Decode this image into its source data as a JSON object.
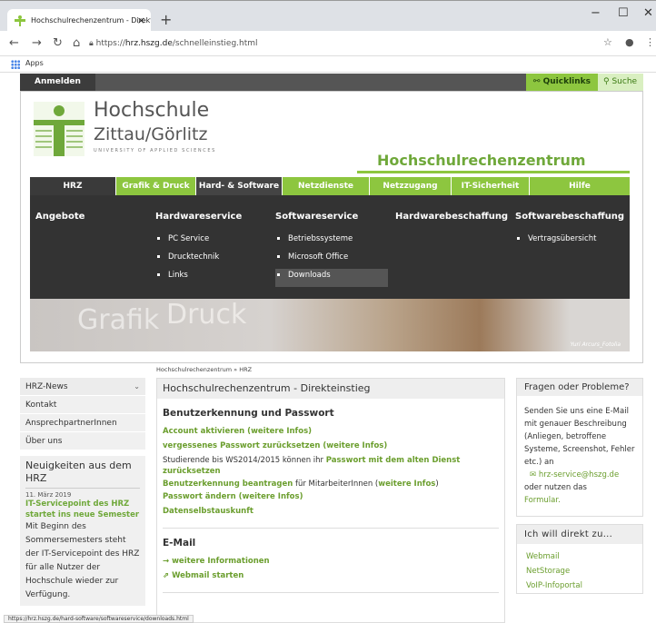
{
  "browser": {
    "tab_title": "Hochschulrechenzentrum - Direkt...",
    "tab_close": "×",
    "new_tab": "+",
    "win_min": "−",
    "win_max": "☐",
    "win_close": "✕",
    "url_prefix": "https://",
    "url_domain": "hrz.hszg.de",
    "url_path": "/schnelleinstieg.html",
    "bookmarks_apps": "Apps",
    "status_url": "https://hrz.hszg.de/hard-software/softwareservice/downloads.html"
  },
  "site": {
    "login": "Anmelden",
    "quicklinks": "Quicklinks",
    "search": "Suche",
    "logo_line1": "Hochschule",
    "logo_line2": "Zittau/Görlitz",
    "logo_sub": "UNIVERSITY OF APPLIED SCIENCES",
    "site_title": "Hochschulrechenzentrum",
    "menu": [
      "HRZ",
      "Grafik & Druck",
      "Hard- & Software",
      "Netzdienste",
      "Netzzugang",
      "IT-Sicherheit",
      "Hilfe"
    ],
    "mega": {
      "angebote": "Angebote",
      "hardwareservice": {
        "title": "Hardwareservice",
        "items": [
          "PC Service",
          "Drucktechnik",
          "Links"
        ]
      },
      "softwareservice": {
        "title": "Softwareservice",
        "items": [
          "Betriebssysteme",
          "Microsoft Office",
          "Downloads"
        ]
      },
      "hardwarebeschaffung": "Hardwarebeschaffung",
      "softwarebeschaffung": {
        "title": "Softwarebeschaffung",
        "items": [
          "Vertragsübersicht"
        ]
      }
    },
    "banner": {
      "word1": "Grafik",
      "word2": "Druck",
      "credit": "Yuri Arcurs_Fotolia"
    },
    "breadcrumb": "Hochschulrechenzentrum » HRZ"
  },
  "sidebar": {
    "items": [
      "HRZ-News",
      "Kontakt",
      "AnsprechpartnerInnen",
      "Über uns"
    ],
    "news_heading": "Neuigkeiten aus dem HRZ",
    "news_date": "11. März 2019",
    "news_title": "IT-Servicepoint des HRZ startet ins neue Semester",
    "news_body": "Mit Beginn des Sommersemesters steht der IT-Servicepoint des HRZ für alle Nutzer der Hochschule wieder zur Verfügung."
  },
  "main": {
    "heading": "Hochschulrechenzentrum - Direkteinstieg",
    "sec1": "Benutzerkennung und Passwort",
    "l1a": "Account aktivieren (",
    "l1b": "weitere Infos",
    "l1c": ")",
    "l2a": "vergessenes Passwort zurücksetzen (",
    "l2b": "weitere Infos",
    "l2c": ")",
    "t3a": "Studierende bis WS2014/2015 können ihr ",
    "t3b": "Passwort mit dem alten Dienst zurücksetzen",
    "t4a": "Benutzerkennung beantragen",
    "t4b": " für MitarbeiterInnen (",
    "t4c": "weitere Infos",
    "t4d": ")",
    "l5a": "Passwort ändern (",
    "l5b": "weitere Infos",
    "l5c": ")",
    "l6": "Datenselbstauskunft",
    "sec2": "E-Mail",
    "m1": "→ weitere Informationen",
    "m2": "⇗ Webmail starten"
  },
  "right": {
    "q_heading": "Fragen oder Probleme?",
    "q_text1": "Senden Sie uns eine E-Mail mit genauer Beschreibung (Anliegen, betroffene Systeme, Screenshot, Fehler etc.) an",
    "q_mail": "✉ hrz-service@hszg.de",
    "q_text2": "oder nutzen das",
    "q_form": "Formular.",
    "direct_heading": "Ich will direkt zu...",
    "direct_links": [
      "Webmail",
      "NetStorage",
      "VoIP-Infoportal"
    ]
  },
  "colors": {
    "accent": "#8dc63f",
    "dark": "#333333"
  }
}
